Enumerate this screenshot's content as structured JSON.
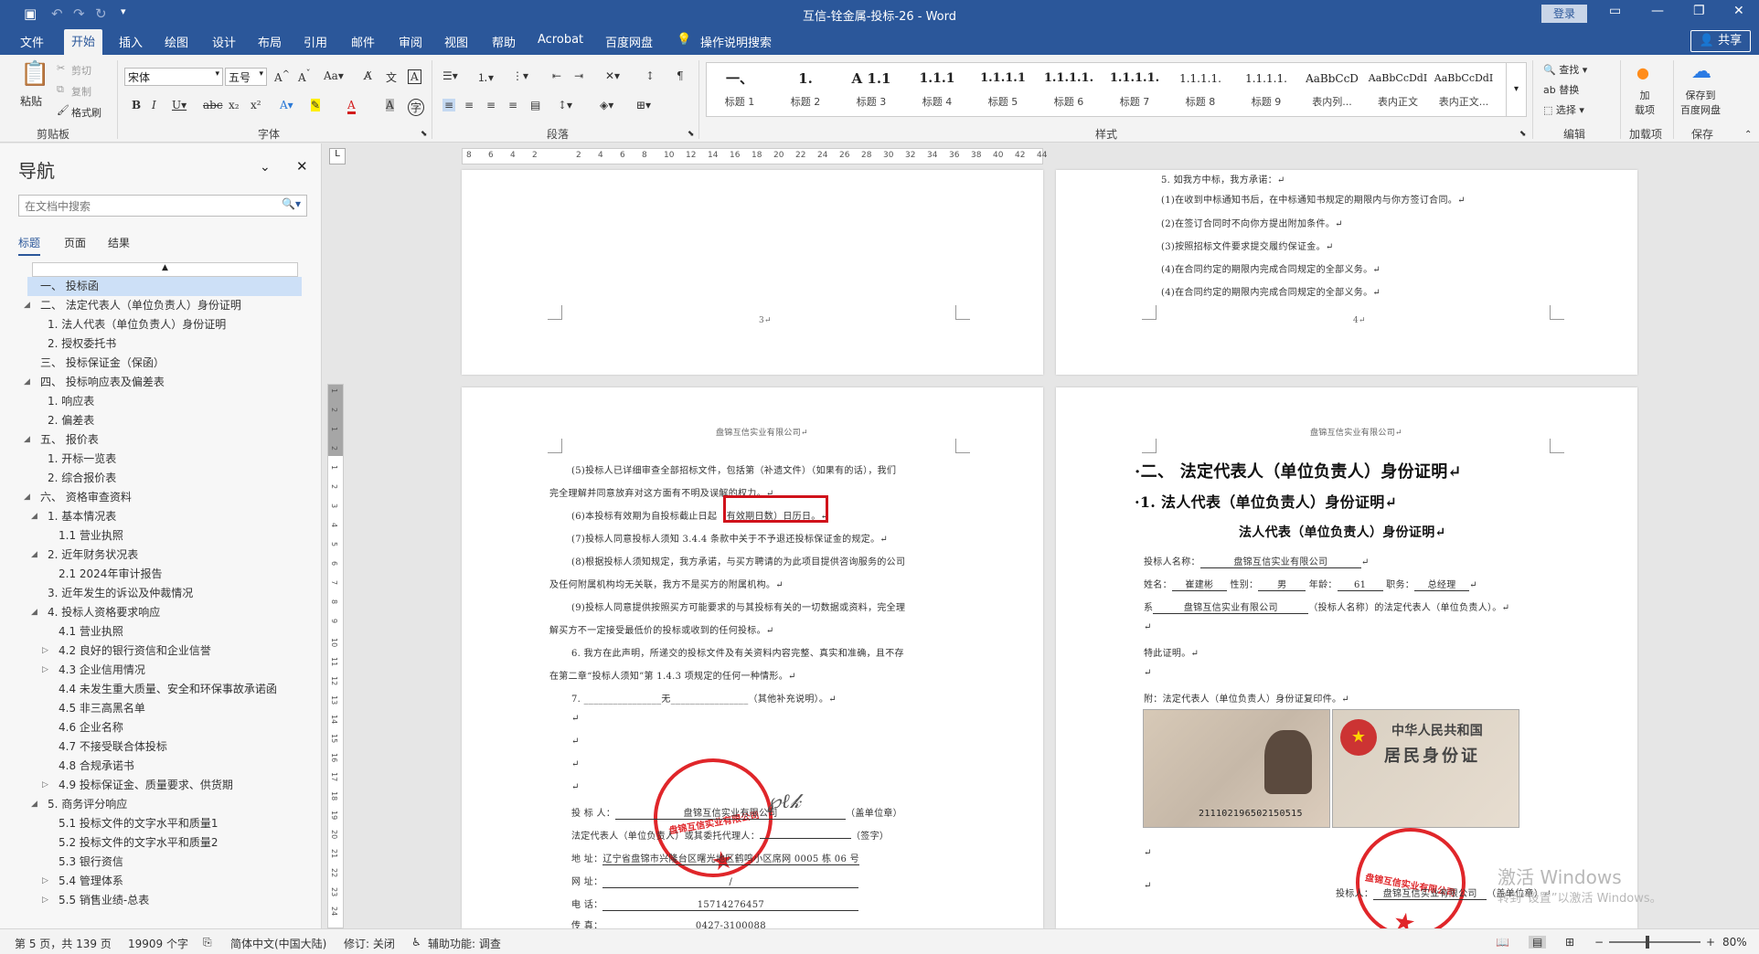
{
  "window": {
    "title": "互信-铨金属-投标-26 - Word",
    "login": "登录",
    "share": "共享"
  },
  "tabs": [
    "文件",
    "开始",
    "插入",
    "绘图",
    "设计",
    "布局",
    "引用",
    "邮件",
    "审阅",
    "视图",
    "帮助",
    "Acrobat",
    "百度网盘",
    "操作说明搜索"
  ],
  "ribbon": {
    "clipboard": {
      "paste": "粘贴",
      "cut": "剪切",
      "copy": "复制",
      "painter": "格式刷",
      "label": "剪贴板"
    },
    "font": {
      "name": "宋体",
      "size": "五号",
      "label": "字体"
    },
    "paragraph": {
      "label": "段落"
    },
    "styles": {
      "label": "样式",
      "items": [
        {
          "preview": "一、",
          "name": "标题 1"
        },
        {
          "preview": "1.",
          "name": "标题 2"
        },
        {
          "preview": "A 1.1",
          "name": "标题 3"
        },
        {
          "preview": "1.1.1",
          "name": "标题 4"
        },
        {
          "preview": "1.1.1.1",
          "name": "标题 5"
        },
        {
          "preview": "1.1.1.1.",
          "name": "标题 6"
        },
        {
          "preview": "1.1.1.1.",
          "name": "标题 7"
        },
        {
          "preview": "1.1.1.1.",
          "name": "标题 8"
        },
        {
          "preview": "1.1.1.1.",
          "name": "标题 9"
        },
        {
          "preview": "AaBbCcD",
          "name": "表内列..."
        },
        {
          "preview": "AaBbCcDdI",
          "name": "表内正文"
        },
        {
          "preview": "AaBbCcDdI",
          "name": "表内正文..."
        }
      ]
    },
    "editing": {
      "find": "查找",
      "replace": "替换",
      "select": "选择",
      "label": "编辑"
    },
    "addin": {
      "btn": "加\n载项",
      "label": "加载项"
    },
    "save": {
      "btn": "保存到\n百度网盘",
      "label": "保存"
    }
  },
  "nav": {
    "title": "导航",
    "search_placeholder": "在文档中搜索",
    "tabs": [
      "标题",
      "页面",
      "结果"
    ],
    "items": [
      {
        "text": "一、 投标函",
        "level": 0,
        "sel": true,
        "tri": ""
      },
      {
        "text": "二、 法定代表人（单位负责人）身份证明",
        "level": 0,
        "tri": "◢"
      },
      {
        "text": "1. 法人代表（单位负责人）身份证明",
        "level": 1,
        "tri": ""
      },
      {
        "text": "2. 授权委托书",
        "level": 1,
        "tri": ""
      },
      {
        "text": "三、 投标保证金（保函）",
        "level": 0,
        "tri": ""
      },
      {
        "text": "四、 投标响应表及偏差表",
        "level": 0,
        "tri": "◢"
      },
      {
        "text": "1. 响应表",
        "level": 1,
        "tri": ""
      },
      {
        "text": "2. 偏差表",
        "level": 1,
        "tri": ""
      },
      {
        "text": "五、 报价表",
        "level": 0,
        "tri": "◢"
      },
      {
        "text": "1. 开标一览表",
        "level": 1,
        "tri": ""
      },
      {
        "text": "2. 综合报价表",
        "level": 1,
        "tri": ""
      },
      {
        "text": "六、 资格审查资料",
        "level": 0,
        "tri": "◢"
      },
      {
        "text": "1. 基本情况表",
        "level": 1,
        "tri": "◢"
      },
      {
        "text": "1.1 营业执照",
        "level": 2,
        "tri": ""
      },
      {
        "text": "2. 近年财务状况表",
        "level": 1,
        "tri": "◢"
      },
      {
        "text": "2.1 2024年审计报告",
        "level": 2,
        "tri": ""
      },
      {
        "text": "3. 近年发生的诉讼及仲裁情况",
        "level": 1,
        "tri": ""
      },
      {
        "text": "4. 投标人资格要求响应",
        "level": 1,
        "tri": "◢"
      },
      {
        "text": "4.1 营业执照",
        "level": 2,
        "tri": ""
      },
      {
        "text": "4.2 良好的银行资信和企业信誉",
        "level": 2,
        "tri": "▷"
      },
      {
        "text": "4.3 企业信用情况",
        "level": 2,
        "tri": "▷"
      },
      {
        "text": "4.4 未发生重大质量、安全和环保事故承诺函",
        "level": 2,
        "tri": ""
      },
      {
        "text": "4.5 非三高黑名单",
        "level": 2,
        "tri": ""
      },
      {
        "text": "4.6 企业名称",
        "level": 2,
        "tri": ""
      },
      {
        "text": "4.7 不接受联合体投标",
        "level": 2,
        "tri": ""
      },
      {
        "text": "4.8 合规承诺书",
        "level": 2,
        "tri": ""
      },
      {
        "text": "4.9 投标保证金、质量要求、供货期",
        "level": 2,
        "tri": "▷"
      },
      {
        "text": "5. 商务评分响应",
        "level": 1,
        "tri": "◢"
      },
      {
        "text": "5.1 投标文件的文字水平和质量1",
        "level": 2,
        "tri": ""
      },
      {
        "text": "5.2 投标文件的文字水平和质量2",
        "level": 2,
        "tri": ""
      },
      {
        "text": "5.3 银行资信",
        "level": 2,
        "tri": ""
      },
      {
        "text": "5.4 管理体系",
        "level": 2,
        "tri": "▷"
      },
      {
        "text": "5.5 销售业绩-总表",
        "level": 2,
        "tri": "▷"
      }
    ]
  },
  "pages": {
    "p3": {
      "num": "3↵"
    },
    "p4": {
      "num": "4↵",
      "lines": [
        "5. 如我方中标，我方承诺：↵",
        "(1)在收到中标通知书后，在中标通知书规定的期限内与你方签订合同。↵",
        "(2)在签订合同时不向你方提出附加条件。↵",
        "(3)按照招标文件要求提交履约保证金。↵",
        "(4)在合同约定的期限内完成合同规定的全部义务。↵",
        "(4)在合同约定的期限内完成合同规定的全部义务。↵"
      ]
    },
    "p5": {
      "header": "盘锦互信实业有限公司↵",
      "lines": [
        "(5)投标人已详细审查全部招标文件，包括第（补遗文件）（如果有的话），我们",
        "完全理解并同意放弃对这方面有不明及误解的权力。↵",
        "(6)本投标有效期为自投标截止日起（有效期日数）日历日。↵",
        "(7)投标人同意投标人须知 3.4.4 条款中关于不予退还投标保证金的规定。↵",
        "(8)根据投标人须知规定，我方承诺，与买方聘请的为此项目提供咨询服务的公司",
        "及任何附属机构均无关联，我方不是买方的附属机构。↵",
        "(9)投标人同意提供按照买方可能要求的与其投标有关的一切数据或资料，完全理",
        "解买方不一定接受最低价的投标或收到的任何投标。↵",
        "6. 我方在此声明，所递交的投标文件及有关资料内容完整、真实和准确，且不存",
        "在第二章“投标人须知”第 1.4.3 项规定的任何一种情形。↵",
        "7. ________________无________________（其他补充说明）。↵"
      ],
      "sign": {
        "bidder_label": "投 标 人：",
        "bidder": "盘锦互信实业有限公司",
        "bidder_suffix": "（盖单位章）",
        "rep_label": "法定代表人（单位负责人）或其委托代理人：",
        "rep_suffix": "（签字）",
        "addr_label": "地    址：",
        "addr": "辽宁省盘锦市兴隆台区曙光地区鹤鸣小区席网 0005 栋 06 号",
        "web_label": "网    址：",
        "web": "/",
        "tel_label": "电    话：",
        "tel": "15714276457",
        "fax_label": "传    真：",
        "fax": "0427-3100088"
      },
      "stamp": "盘锦互信实业有限公司"
    },
    "p6": {
      "header": "盘锦互信实业有限公司↵",
      "h1": "·二、 法定代表人（单位负责人）身份证明↵",
      "h2": "·1. 法人代表（单位负责人）身份证明↵",
      "h3": "法人代表（单位负责人）身份证明↵",
      "bidder_label": "投标人名称：",
      "bidder": "盘锦互信实业有限公司",
      "name_label": "姓名：",
      "name": "崔建彬",
      "gender_label": "性别：",
      "gender": "男",
      "age_label": "年龄：",
      "age": "61",
      "title_label": "职务：",
      "title": "总经理",
      "system_label": "系",
      "system_suffix": "（投标人名称）的法定代表人（单位负责人）。↵",
      "special": "特此证明。↵",
      "attach": "附：法定代表人（单位负责人）身份证复印件。↵",
      "id_card_title": "中华人民共和国",
      "id_card_sub": "居民身份证",
      "id_number": "211102196502150515",
      "sign_label": "投标人：",
      "sign_suffix": "（盖单位章）↵",
      "stamp": "盘锦互信实业有限公司"
    }
  },
  "statusbar": {
    "page": "第 5 页，共 139 页",
    "words": "19909 个字",
    "lang": "简体中文(中国大陆)",
    "track": "修订: 关闭",
    "access": "辅助功能: 调查",
    "zoom": "80%"
  },
  "watermark": {
    "line1": "激活 Windows",
    "line2": "转到“设置”以激活 Windows。"
  }
}
